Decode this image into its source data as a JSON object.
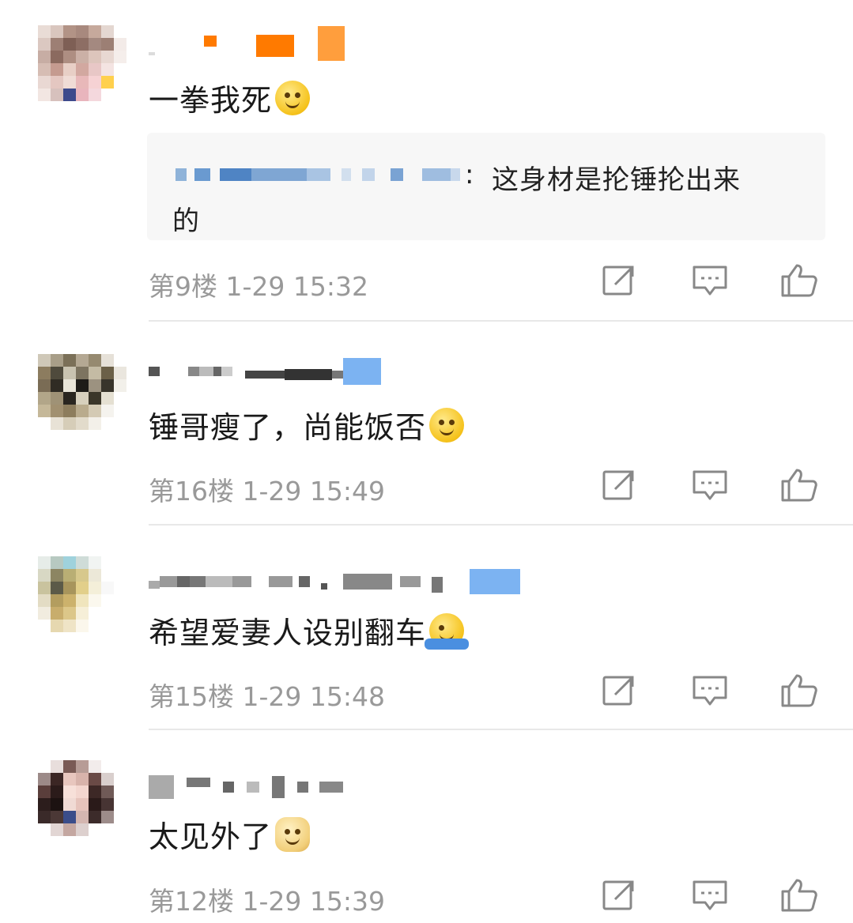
{
  "comments": [
    {
      "text": "一拳我死",
      "emoji_icon": "hug-face-icon",
      "quote": {
        "separator": ":",
        "text_line1": " 这身材是抡锤抡出来",
        "text_line2": "的"
      },
      "floor": "第9楼",
      "time": "1-29 15:32"
    },
    {
      "text": "锤哥瘦了，尚能饭否",
      "emoji_icon": "smirk-face-icon",
      "floor": "第16楼",
      "time": "1-29 15:49"
    },
    {
      "text": "希望爱妻人设别翻车",
      "emoji_icon": "shrug-face-icon",
      "floor": "第15楼",
      "time": "1-29 15:48"
    },
    {
      "text": "太见外了",
      "emoji_icon": "doge-icon",
      "floor": "第12楼",
      "time": "1-29 15:39"
    }
  ],
  "icons": {
    "repost": "repost-icon",
    "reply": "comment-icon",
    "like": "thumbs-up-icon"
  },
  "colors": {
    "meta_text": "#999999",
    "quote_bg": "#f7f7f7",
    "divider": "#e8e8e8"
  }
}
